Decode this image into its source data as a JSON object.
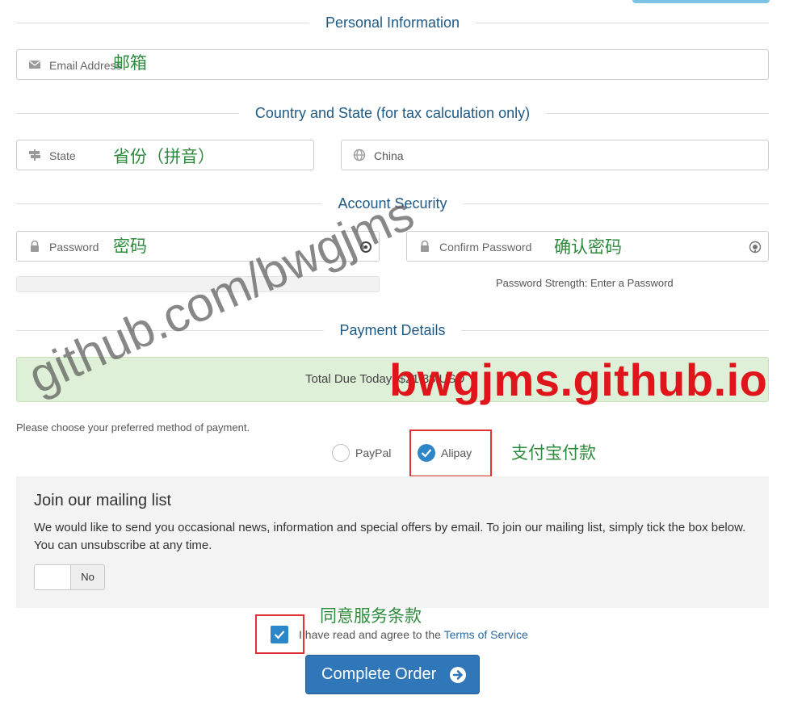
{
  "sections": {
    "personal": "Personal Information",
    "country": "Country and State (for tax calculation only)",
    "security": "Account Security",
    "payment": "Payment Details"
  },
  "fields": {
    "email_placeholder": "Email Address",
    "state_placeholder": "State",
    "country_value": "China",
    "password_placeholder": "Password",
    "confirm_placeholder": "Confirm Password"
  },
  "annotations": {
    "email": "邮箱",
    "state": "省份（拼音）",
    "password": "密码",
    "confirm": "确认密码",
    "pay": "支付宝付款",
    "tos": "同意服务条款",
    "site": "bwgjms.github.io",
    "watermark": "github.com/bwgjms"
  },
  "password_strength": "Password Strength: Enter a Password",
  "payment": {
    "total_label": "Total Due Today:",
    "total_value": "$21.38 USD",
    "choose_text": "Please choose your preferred method of payment.",
    "options": [
      "PayPal",
      "Alipay"
    ],
    "selected": "Alipay"
  },
  "mailing": {
    "title": "Join our mailing list",
    "text": "We would like to send you occasional news, information and special offers by email. To join our mailing list, simply tick the box below. You can unsubscribe at any time.",
    "toggle_state": "No"
  },
  "tos": {
    "prefix": "I have read and agree to the",
    "link": "Terms of Service",
    "checked": true
  },
  "submit_label": "Complete Order",
  "colors": {
    "accent": "#2f77b8",
    "section_title": "#1f5a85",
    "total_bg": "#dff0d8",
    "annotation_green": "#2e8b3d",
    "annotation_red": "#e0151b"
  },
  "icons": [
    "envelope-icon",
    "signpost-icon",
    "globe-icon",
    "lock-icon",
    "eye-icon",
    "check-icon",
    "arrow-right-circle-icon"
  ]
}
